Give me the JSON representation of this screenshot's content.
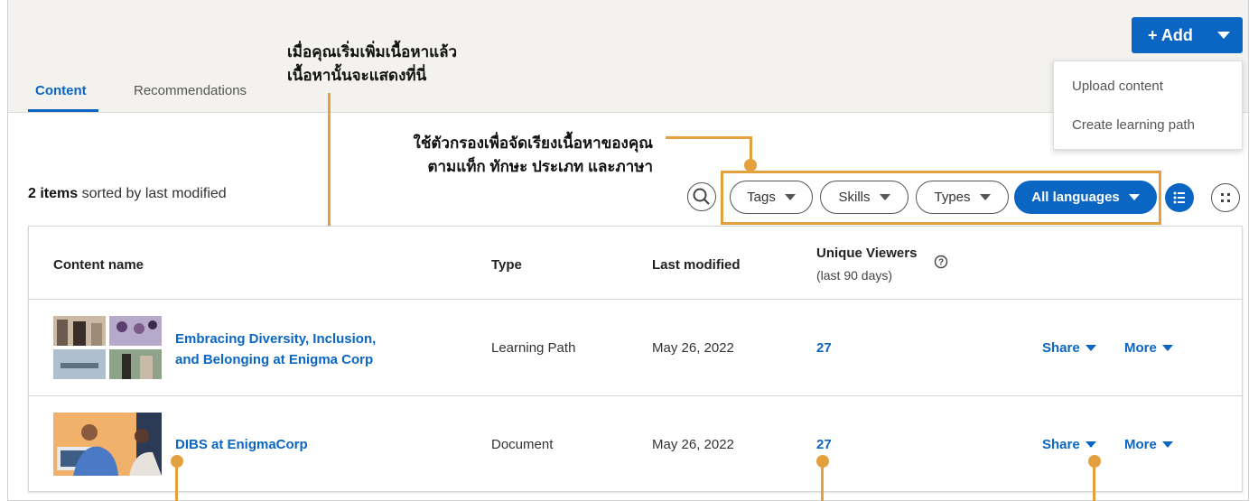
{
  "tabs": [
    {
      "label": "Content",
      "active": true
    },
    {
      "label": "Recommendations",
      "active": false
    }
  ],
  "add_button": {
    "label": "+ Add"
  },
  "add_menu": [
    "Upload content",
    "Create learning path"
  ],
  "annotations": {
    "content_line1": "เมื่อคุณเริ่มเพิ่มเนื้อหาแล้ว",
    "content_line2": "เนื้อหานั้นจะแสดงที่นี่",
    "filter_line1": "ใช้ตัวกรองเพื่อจัดเรียงเนื้อหาของคุณ",
    "filter_line2": "ตามแท็ก ทักษะ ประเภท และภาษา"
  },
  "summary": {
    "count_bold": "2 items",
    "count_rest": " sorted by last modified"
  },
  "filters": [
    {
      "label": "Tags",
      "selected": false
    },
    {
      "label": "Skills",
      "selected": false
    },
    {
      "label": "Types",
      "selected": false
    },
    {
      "label": "All languages",
      "selected": true
    }
  ],
  "table": {
    "headers": {
      "name": "Content name",
      "type": "Type",
      "modified": "Last modified",
      "viewers": "Unique Viewers",
      "viewers_sub": "(last 90 days)"
    },
    "rows": [
      {
        "title_line1": "Embracing Diversity, Inclusion,",
        "title_line2": "and Belonging at Enigma Corp",
        "type": "Learning Path",
        "modified": "May 26, 2022",
        "viewers": "27",
        "share": "Share",
        "more": "More"
      },
      {
        "title_line1": "DIBS at EnigmaCorp",
        "type": "Document",
        "modified": "May 26, 2022",
        "viewers": "27",
        "share": "Share",
        "more": "More"
      }
    ]
  },
  "colors": {
    "accent": "#0a66c2",
    "callout": "#e2a03f"
  }
}
